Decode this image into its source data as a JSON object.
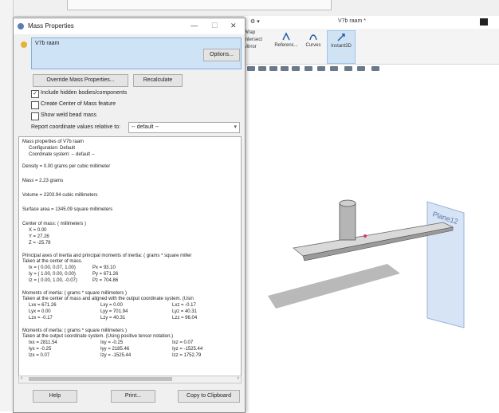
{
  "dialog": {
    "title": "Mass Properties",
    "selection": "V7b raam",
    "options_label": "Options...",
    "override_label": "Override Mass Properties...",
    "recalc_label": "Recalculate",
    "checks": [
      {
        "label": "Include hidden bodies/components",
        "checked": true
      },
      {
        "label": "Create Center of Mass feature",
        "checked": false
      },
      {
        "label": "Show weld bead mass",
        "checked": false
      }
    ],
    "report_label": "Report coordinate values relative to:",
    "report_value": "-- default --",
    "results": {
      "line1": "Mass properties of V7b raam",
      "line2": "Configuration: Default",
      "line3": "Coordinate system: -- default --",
      "density": "Density = 0.00 grams per cubic millimeter",
      "mass": "Mass = 2.23 grams",
      "volume": "Volume = 2203.94 cubic millimeters",
      "surface": "Surface area = 1345.09  square millimeters",
      "com_title": "Center of mass: ( millimeters )",
      "com_x": "X = 0.00",
      "com_y": "Y = 27.26",
      "com_z": "Z = -25.79",
      "pa_title": "Principal axes of inertia and principal moments of inertia: ( grams *  square miller",
      "pa_sub": "Taken at the center of mass.",
      "ix": "Ix = ( 0.00,  0.07,  1.00)",
      "px": "Px = 93.10",
      "iy": "Iy = ( 1.00,  0.00,  0.00)",
      "py": "Py = 671.26",
      "iz": "Iz = ( 0.00,  1.00, -0.07)",
      "pz": "Pz = 704.86",
      "moi1_title": "Moments of inertia: ( grams *  square millimeters )",
      "moi1_sub": "Taken at the center of mass and aligned with the output coordinate system. (Usin",
      "lxx": "Lxx = 671.26",
      "lxy": "Lxy = 0.00",
      "lxz": "Lxz = -0.17",
      "lyx": "Lyx = 0.00",
      "lyy": "Lyy = 701.94",
      "lyz": "Lyz = 40.31",
      "lzx": "Lzx = -0.17",
      "lzy": "Lzy = 40.31",
      "lzz": "Lzz = 96.04",
      "moi2_title": "Moments of inertia: ( grams *  square millimeters )",
      "moi2_sub": "Taken at the output coordinate system. (Using positive tensor notation.)",
      "ixx": "Ixx = 2811.54",
      "ixy": "Ixy = -0.25",
      "ixz": "Ixz = 0.07",
      "iyx": "Iyx = -0.25",
      "iyy": "Iyy = 2185.46",
      "iyz": "Iyz = -1525.44",
      "izx": "Izx = 0.07",
      "izy": "Izy = -1525.44",
      "izz": "Izz = 1752.79"
    },
    "help_label": "Help",
    "print_label": "Print...",
    "copy_label": "Copy to Clipboard"
  },
  "app": {
    "doc_title": "V7b raam *",
    "ribbon": [
      "Wrap",
      "Intersect",
      "Mirror",
      "Referenc...",
      "Curves",
      "Instant3D"
    ],
    "plane_label": "Plane12",
    "accent": "#0078d7"
  }
}
